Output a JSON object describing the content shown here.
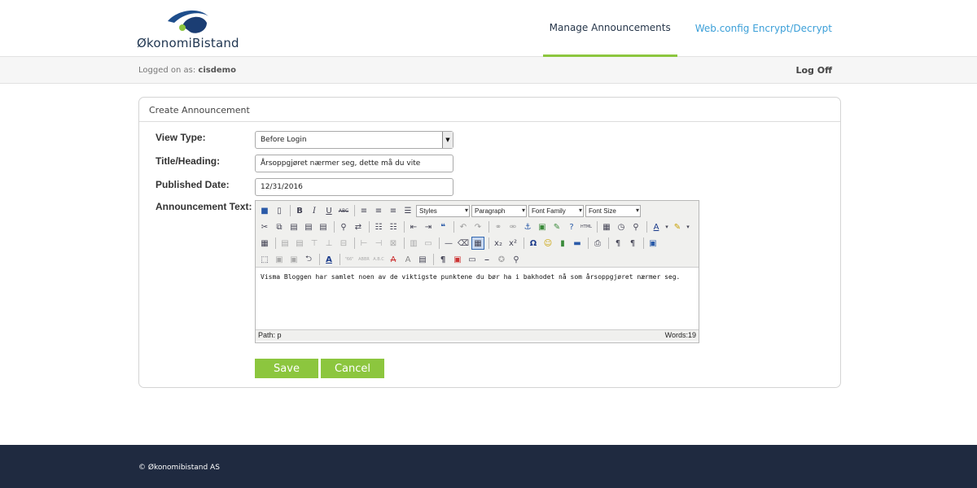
{
  "header": {
    "logo_text": "ØkonomiBistand",
    "nav": [
      {
        "label": "Manage Announcements"
      },
      {
        "label": "Web.config Encrypt/Decrypt"
      }
    ]
  },
  "logbar": {
    "logged_prefix": "Logged on as:",
    "username": "cisdemo",
    "logoff": "Log Off"
  },
  "form": {
    "title": "Create Announcement",
    "view_type_label": "View Type:",
    "view_type_value": "Before Login",
    "title_label": "Title/Heading:",
    "title_value": "Årsoppgjøret nærmer seg, dette må du vite",
    "date_label": "Published Date:",
    "date_value": "12/31/2016",
    "text_label": "Announcement Text:",
    "editor": {
      "styles": "Styles",
      "format": "Paragraph",
      "font_family": "Font Family",
      "font_size": "Font Size",
      "content": "Visma Bloggen har samlet noen av de viktigste punktene du bør ha i bakhodet nå som årsoppgjøret nærmer seg.",
      "path": "Path: p",
      "words": "Words:19"
    },
    "save": "Save",
    "cancel": "Cancel"
  },
  "footer": {
    "copyright": "© Økonomibistand AS"
  },
  "colors": {
    "accent": "#8cc63e",
    "link": "#3b9fd8",
    "footer": "#1f2a40"
  }
}
